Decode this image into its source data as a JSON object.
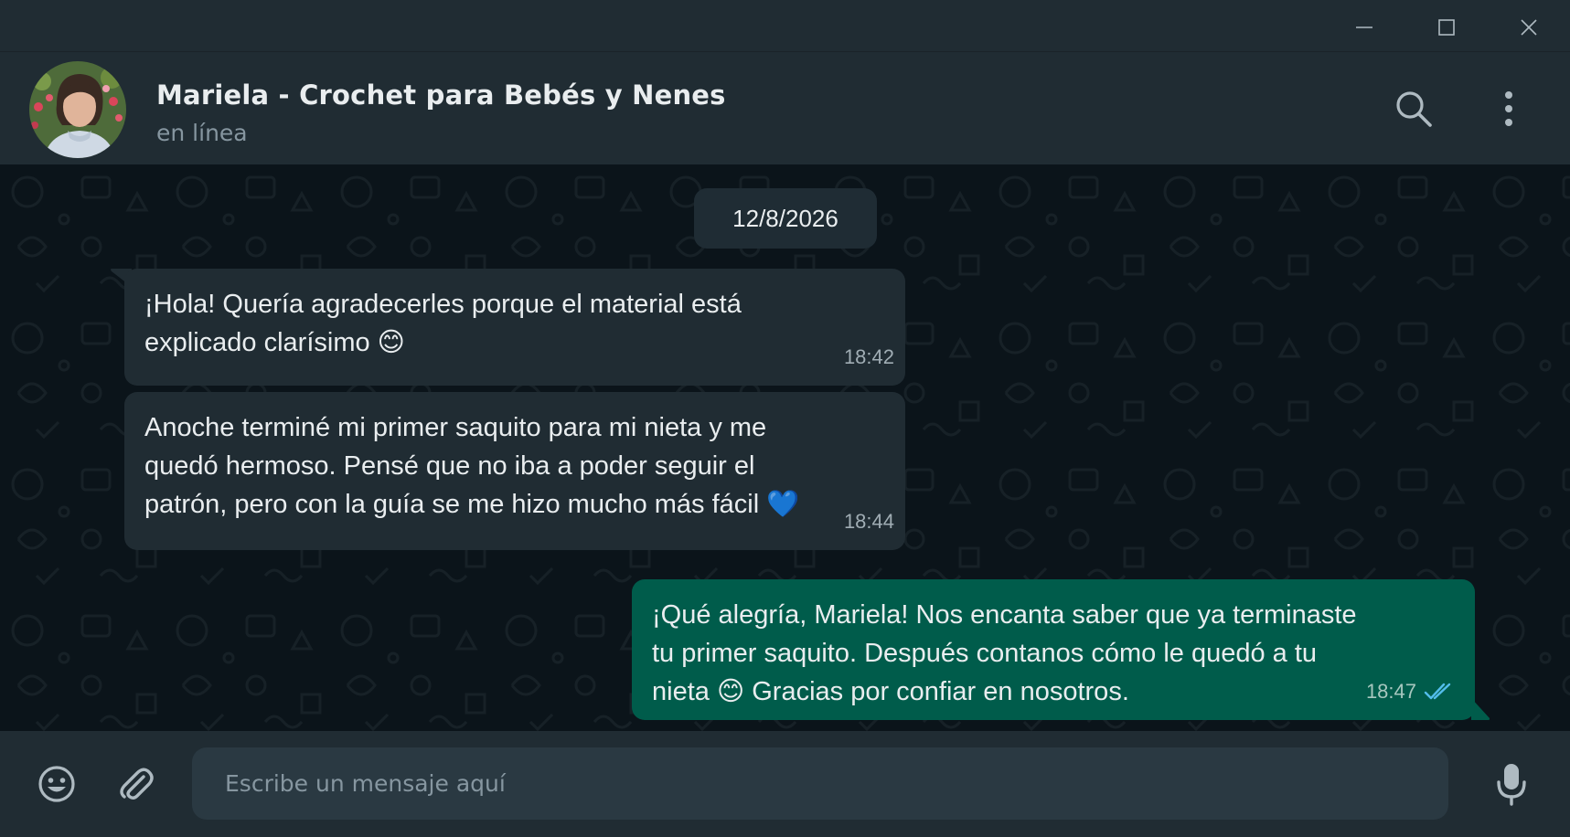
{
  "window": {
    "minimize_icon": "minimize-icon",
    "maximize_icon": "maximize-icon",
    "close_icon": "close-icon"
  },
  "header": {
    "contact_name": "Mariela - Crochet para Bebés y Nenes",
    "status": "en línea",
    "search_icon": "search-icon",
    "menu_icon": "more-vertical-icon"
  },
  "chat": {
    "date_chip": "12/8/2026",
    "messages": [
      {
        "direction": "incoming",
        "lines": [
          "¡Hola! Quería agradecerles porque el material está",
          "explicado clarísimo 😊"
        ],
        "time": "18:42"
      },
      {
        "direction": "incoming",
        "lines": [
          "Anoche terminé mi primer saquito para mi nieta y me",
          "quedó hermoso. Pensé que no iba a poder seguir el",
          "patrón, pero con la guía se me hizo mucho más fácil 💙"
        ],
        "time": "18:44"
      },
      {
        "direction": "outgoing",
        "lines": [
          "¡Qué alegría, Mariela! Nos encanta saber que ya terminaste",
          "tu primer saquito. Después contanos cómo le quedó a tu",
          "nieta 😊 Gracias por confiar en nosotros."
        ],
        "time": "18:47",
        "status_icon": "double-check-read-icon"
      }
    ]
  },
  "composer": {
    "placeholder": "Escribe un mensaje aquí",
    "emoji_icon": "emoji-icon",
    "attach_icon": "paperclip-icon",
    "mic_icon": "microphone-icon"
  },
  "colors": {
    "background": "#0b141a",
    "panel": "#202c33",
    "incoming_bubble": "#202c33",
    "outgoing_bubble": "#005c4b",
    "read_receipt": "#53bdeb",
    "secondary_text": "#8696a0"
  }
}
